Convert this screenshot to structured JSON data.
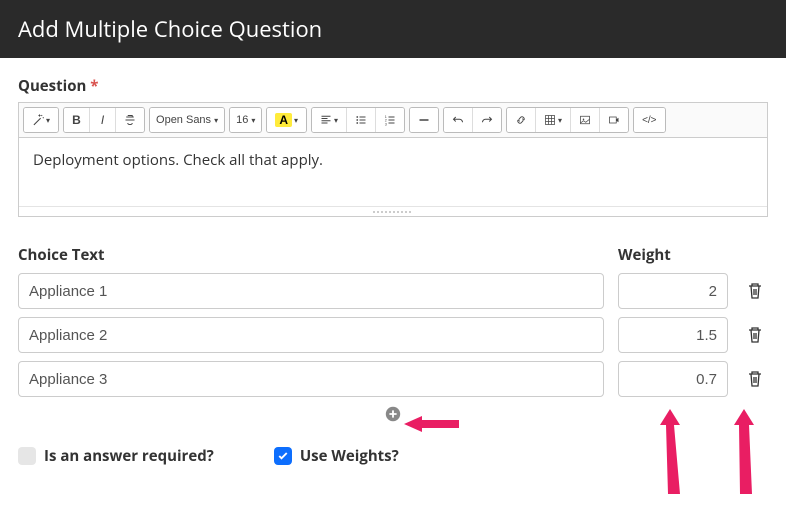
{
  "header": {
    "title": "Add Multiple Choice Question"
  },
  "question": {
    "label": "Question",
    "required_marker": "*",
    "body": "Deployment options.  Check all that apply."
  },
  "toolbar": {
    "font_family": "Open Sans",
    "font_size": "16"
  },
  "columns": {
    "choice_label": "Choice Text",
    "weight_label": "Weight"
  },
  "choices": [
    {
      "text": "Appliance 1",
      "weight": "2"
    },
    {
      "text": "Appliance 2",
      "weight": "1.5"
    },
    {
      "text": "Appliance 3",
      "weight": "0.7"
    }
  ],
  "options": {
    "required_label": "Is an answer required?",
    "required_checked": false,
    "weights_label": "Use Weights?",
    "weights_checked": true
  }
}
